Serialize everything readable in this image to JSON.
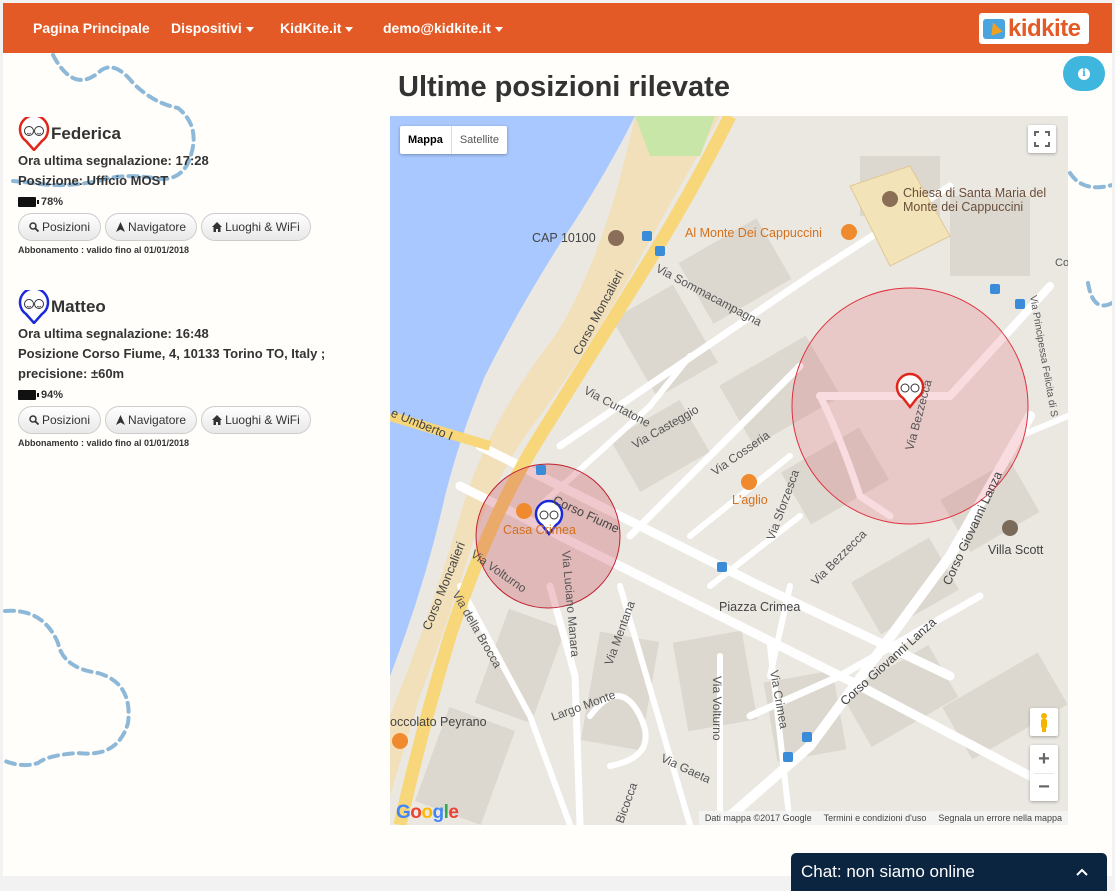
{
  "navbar": {
    "items": [
      {
        "label": "Pagina Principale",
        "caret": false
      },
      {
        "label": "Dispositivi",
        "caret": true
      },
      {
        "label": "KidKite.it",
        "caret": true
      },
      {
        "label": "demo@kidkite.it",
        "caret": true
      }
    ],
    "logo_text": "kidkite"
  },
  "page_title": "Ultime posizioni rilevate",
  "devices": [
    {
      "name": "Federica",
      "marker_color": "#e0261a",
      "last_report": "Ora ultima segnalazione: 17:28",
      "position_lines": [
        "Posizione: Ufficio MOST"
      ],
      "battery": "78%",
      "buttons": {
        "positions": "Posizioni",
        "navigator": "Navigatore",
        "places": "Luoghi & WiFi"
      },
      "subscription": "Abbonamento : valido fino al 01/01/2018"
    },
    {
      "name": "Matteo",
      "marker_color": "#1a2ad8",
      "last_report": "Ora ultima segnalazione: 16:48",
      "position_lines": [
        "Posizione Corso Fiume, 4, 10133 Torino TO, Italy ;",
        "precisione: ±60m"
      ],
      "battery": "94%",
      "buttons": {
        "positions": "Posizioni",
        "navigator": "Navigatore",
        "places": "Luoghi & WiFi"
      },
      "subscription": "Abbonamento : valido fino al 01/01/2018"
    }
  ],
  "map": {
    "type_buttons": {
      "map": "Mappa",
      "satellite": "Satellite"
    },
    "labels": {
      "chiesa_1": "Chiesa di Santa Maria del",
      "chiesa_2": "Monte dei Cappuccini",
      "monte": "Al Monte Dei Cappuccini",
      "cap": "CAP 10100",
      "corso_moncalieri": "Corso Moncalieri",
      "corso_moncalieri2": "Corso Moncalieri",
      "via_sommacampagna": "Via Sommacampagna",
      "via_curtatone": "Via Curtatone",
      "via_casteggio": "Via Casteggio",
      "via_cosseria": "Via Cosseria",
      "corso_fiume": "Corso Fiume",
      "casa_crimea": "Casa Crimea",
      "laglio": "L'aglio",
      "via_sforzesca": "Via Sforzesca",
      "via_bezzecca": "Via Bezzecca",
      "via_bezzecca2": "Via Bezzecca",
      "corso_giovanni_lanza": "Corso Giovanni Lanza",
      "corso_giovanni_lanza2": "Corso Giovanni Lanza",
      "villa_scott": "Villa Scott",
      "piazza_crimea": "Piazza Crimea",
      "via_volturno": "Via Volturno",
      "via_volturno2": "Via Volturno",
      "via_della_brocca": "Via della Brocca",
      "via_luciano_manara": "Via Luciano Manara",
      "via_mentana": "Via Mentana",
      "via_crimea": "Via Crimea",
      "largo_montebello": "Largo Monte",
      "via_gaeta": "Via Gaeta",
      "via_bicocca": "Bicocca",
      "umberto": "e Umberto I",
      "cioccolato": "occolato Peyrano",
      "via_principessa": "Via Principessa Felicita di S",
      "co": "Co"
    },
    "attribution": {
      "data": "Dati mappa ©2017 Google",
      "terms": "Termini e condizioni d'uso",
      "report": "Segnala un errore nella mappa"
    },
    "google_logo": "Google"
  },
  "chat": {
    "label": "Chat: non siamo online"
  },
  "colors": {
    "accent": "#e35a26",
    "info": "#3fb6dd",
    "chat": "#0b2540"
  }
}
